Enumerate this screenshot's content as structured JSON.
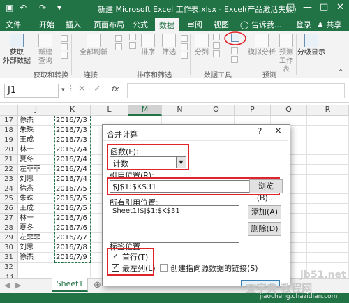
{
  "window": {
    "title": "新建 Microsoft Excel 工作表.xlsx - Excel(产品激活失败)",
    "save_icon": "save-icon",
    "undo_icon": "undo-icon",
    "redo_icon": "redo-icon"
  },
  "tabs": [
    "开始",
    "插入",
    "页面布局",
    "公式",
    "数据",
    "审阅",
    "视图",
    "告诉我..."
  ],
  "active_tab": "数据",
  "account": {
    "login": "登录",
    "share": "共享"
  },
  "ribbon": {
    "get_external": "获取\n外部数据",
    "new_query": "新建\n查询",
    "refresh_all": "全部刷新",
    "sort": "排序",
    "filter": "筛选",
    "split": "分列",
    "what_if": "模拟分析",
    "forecast": "预测\n工作表",
    "outline": "分级显示",
    "groups": [
      "获取和转换",
      "连接",
      "排序和筛选",
      "数据工具",
      "预测"
    ]
  },
  "formula_bar": {
    "name_box": "J1",
    "fx": "fx",
    "value": ""
  },
  "grid": {
    "columns": [
      "J",
      "K",
      "L",
      "M",
      "N",
      "O",
      "P",
      "Q",
      "R"
    ],
    "selected_column": "M",
    "rows": [
      {
        "n": "17",
        "j": "徐杰",
        "k": "2016/7/3"
      },
      {
        "n": "18",
        "j": "朱珠",
        "k": "2016/7/3"
      },
      {
        "n": "19",
        "j": "王成",
        "k": "2016/7/3"
      },
      {
        "n": "20",
        "j": "林一",
        "k": "2016/7/4"
      },
      {
        "n": "21",
        "j": "夏冬",
        "k": "2016/7/4"
      },
      {
        "n": "22",
        "j": "左菲菲",
        "k": "2016/7/4"
      },
      {
        "n": "23",
        "j": "刘思",
        "k": "2016/7/4"
      },
      {
        "n": "24",
        "j": "徐杰",
        "k": "2016/7/5"
      },
      {
        "n": "25",
        "j": "朱珠",
        "k": "2016/7/5"
      },
      {
        "n": "26",
        "j": "王成",
        "k": "2016/7/5"
      },
      {
        "n": "27",
        "j": "林一",
        "k": "2016/7/6"
      },
      {
        "n": "28",
        "j": "夏冬",
        "k": "2016/7/6"
      },
      {
        "n": "29",
        "j": "左菲菲",
        "k": "2016/7/7"
      },
      {
        "n": "30",
        "j": "刘思",
        "k": "2016/7/8"
      },
      {
        "n": "31",
        "j": "徐杰",
        "k": "2016/7/9"
      },
      {
        "n": "32",
        "j": "",
        "k": ""
      },
      {
        "n": "33",
        "j": "",
        "k": ""
      }
    ]
  },
  "sheet_tab": "Sheet1",
  "dialog": {
    "title": "合并计算",
    "help": "?",
    "close": "×",
    "function_label": "函数(F):",
    "function_value": "计数",
    "reference_label": "引用位置(R):",
    "reference_value": "$J$1:$K$31",
    "browse": "浏览(B)...",
    "all_refs_label": "所有引用位置:",
    "all_refs": [
      "Sheet1!$J$1:$K$31"
    ],
    "add": "添加(A)",
    "delete": "删除(D)",
    "labels_section": "标签位置",
    "first_row": "首行(T)",
    "first_row_checked": true,
    "left_column": "最左列(L)",
    "left_column_checked": true,
    "create_links": "创建指向源数据的链接(S)",
    "create_links_checked": false
  },
  "watermark": {
    "site": "jb51.net",
    "brand": "查字典 教程网",
    "url": "jiaocheng.chazidian.com"
  },
  "colors": {
    "excel_green": "#217346",
    "highlight_red": "#e0242b"
  }
}
